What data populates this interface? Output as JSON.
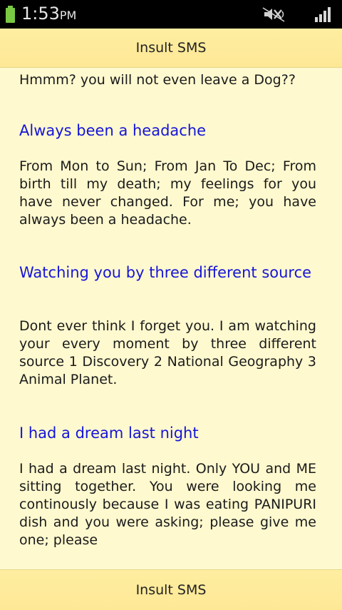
{
  "status_bar": {
    "time": "1:53",
    "ampm": "PM",
    "battery_icon": "battery-icon",
    "mute_icon": "mute-icon",
    "signal_icon": "signal-icon",
    "battery_color": "#7ac943"
  },
  "header": {
    "title": "Insult SMS"
  },
  "footer": {
    "title": "Insult SMS"
  },
  "messages": [
    {
      "body": "Hmmm? you will not even leave a Dog??"
    },
    {
      "title": "Always been a headache",
      "body": "From Mon to Sun; From Jan To Dec; From birth till my death; my feelings for you have never changed. For me; you have always been a headache."
    },
    {
      "title": "Watching you by three different source",
      "body": "Dont ever think I forget you. I am watching your every moment by three different source 1 Discovery 2 National Geography 3 Animal Planet."
    },
    {
      "title": "I had a dream last night",
      "body": "I had a dream last night. Only YOU and ME sitting together. You were looking me continously because I was eating PANIPURI dish and you were asking; please give me one; please"
    }
  ],
  "colors": {
    "background": "#fff9cf",
    "bar": "#fde896",
    "heading": "#1515d8",
    "text": "#1a1a1a"
  }
}
